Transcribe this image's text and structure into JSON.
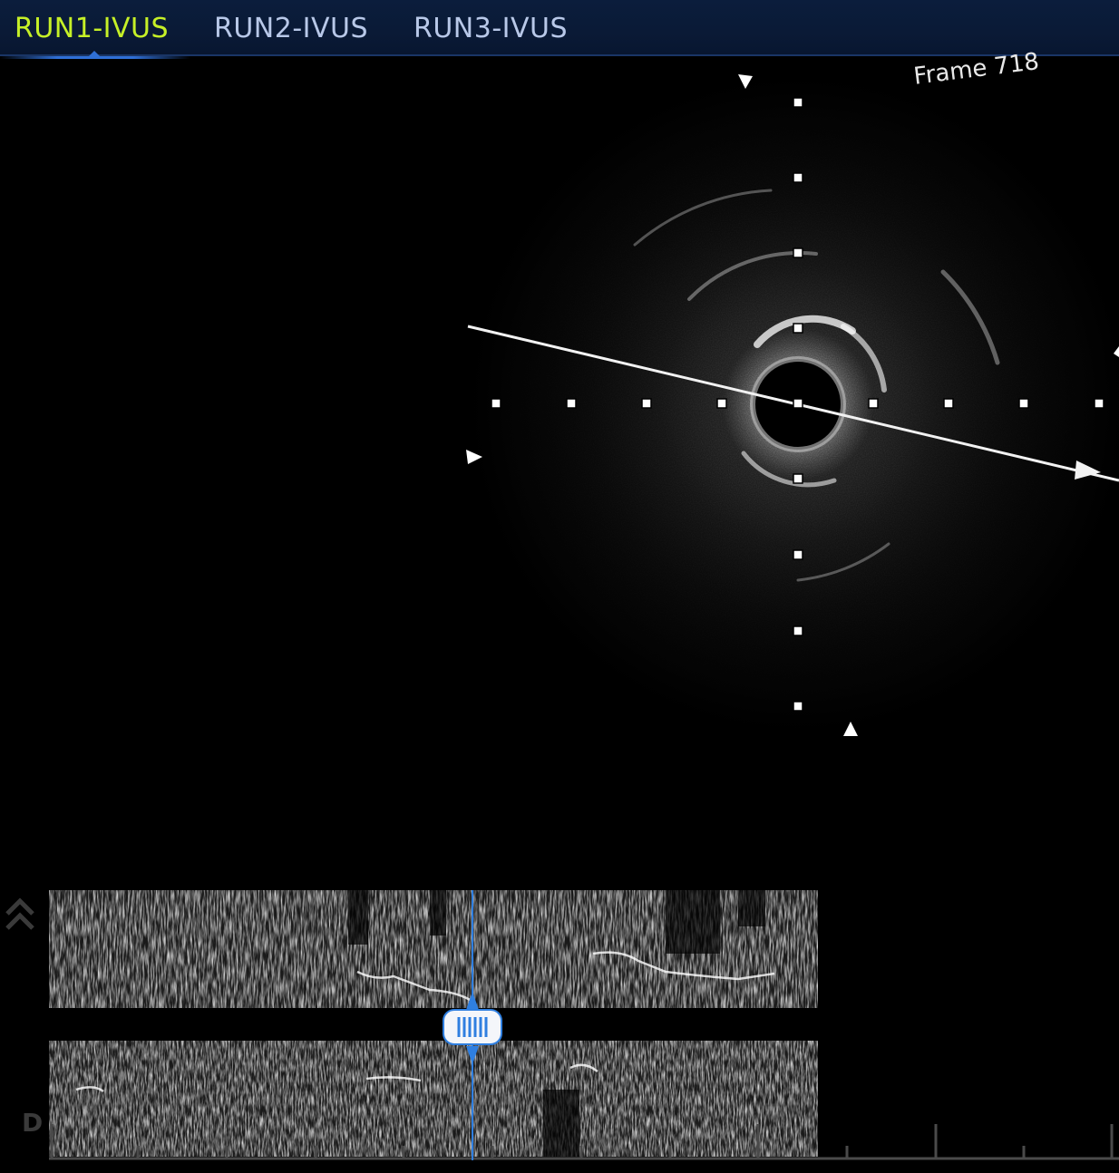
{
  "tabs": [
    {
      "label": "RUN1-IVUS",
      "active": true
    },
    {
      "label": "RUN2-IVUS",
      "active": false
    },
    {
      "label": "RUN3-IVUS",
      "active": false
    }
  ],
  "ivus": {
    "frame_label": "Frame 718"
  },
  "longitudinal": {
    "distal_label": "D"
  },
  "colors": {
    "active_tab": "#c6f027",
    "inactive_tab": "#b8c8e8",
    "accent_blue": "#2f7fe0"
  },
  "icons": {
    "collapse": "double-chevron-up-icon",
    "slider": "frame-slider-handle-icon"
  }
}
